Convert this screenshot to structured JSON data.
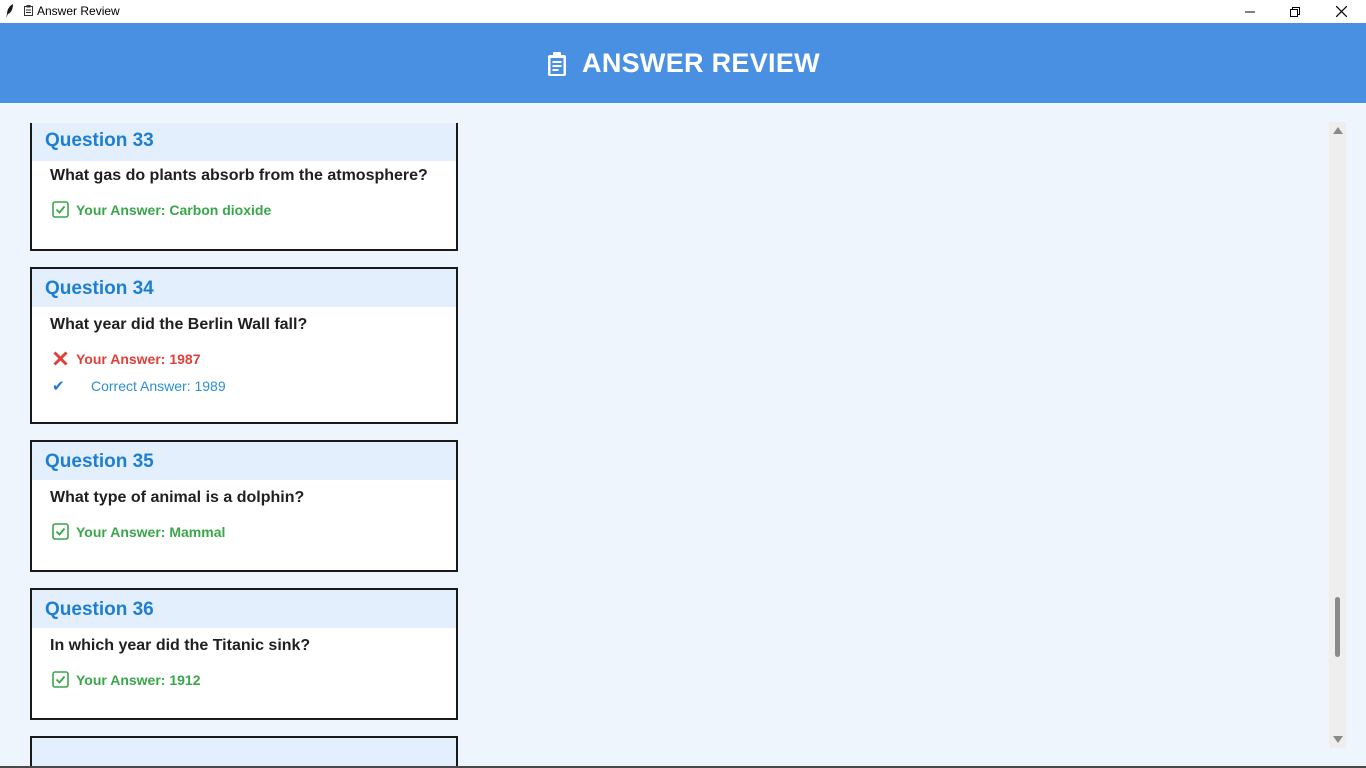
{
  "window": {
    "title": "Answer Review",
    "controls": [
      "minimize",
      "restore",
      "close"
    ]
  },
  "header": {
    "icon": "clipboard-icon",
    "title": "ANSWER REVIEW",
    "background": "#4a90e2"
  },
  "questions": [
    {
      "label": "Question 33",
      "text": "What gas do plants absorb from the atmosphere?",
      "status": "correct",
      "your_answer": "Your Answer: Carbon dioxide"
    },
    {
      "label": "Question 34",
      "text": "What year did the Berlin Wall fall?",
      "status": "wrong",
      "your_answer": "Your Answer: 1987",
      "correct_answer": "Correct Answer: 1989"
    },
    {
      "label": "Question 35",
      "text": "What type of animal is a dolphin?",
      "status": "correct",
      "your_answer": "Your Answer: Mammal"
    },
    {
      "label": "Question 36",
      "text": "In which year did the Titanic sink?",
      "status": "correct",
      "your_answer": "Your Answer: 1912"
    }
  ],
  "colors": {
    "correct": "#3aa64a",
    "wrong": "#e0403a",
    "question_label": "#1e7fd2",
    "correct_answer_text": "#2d8fd6",
    "content_background": "#eef5fd"
  }
}
